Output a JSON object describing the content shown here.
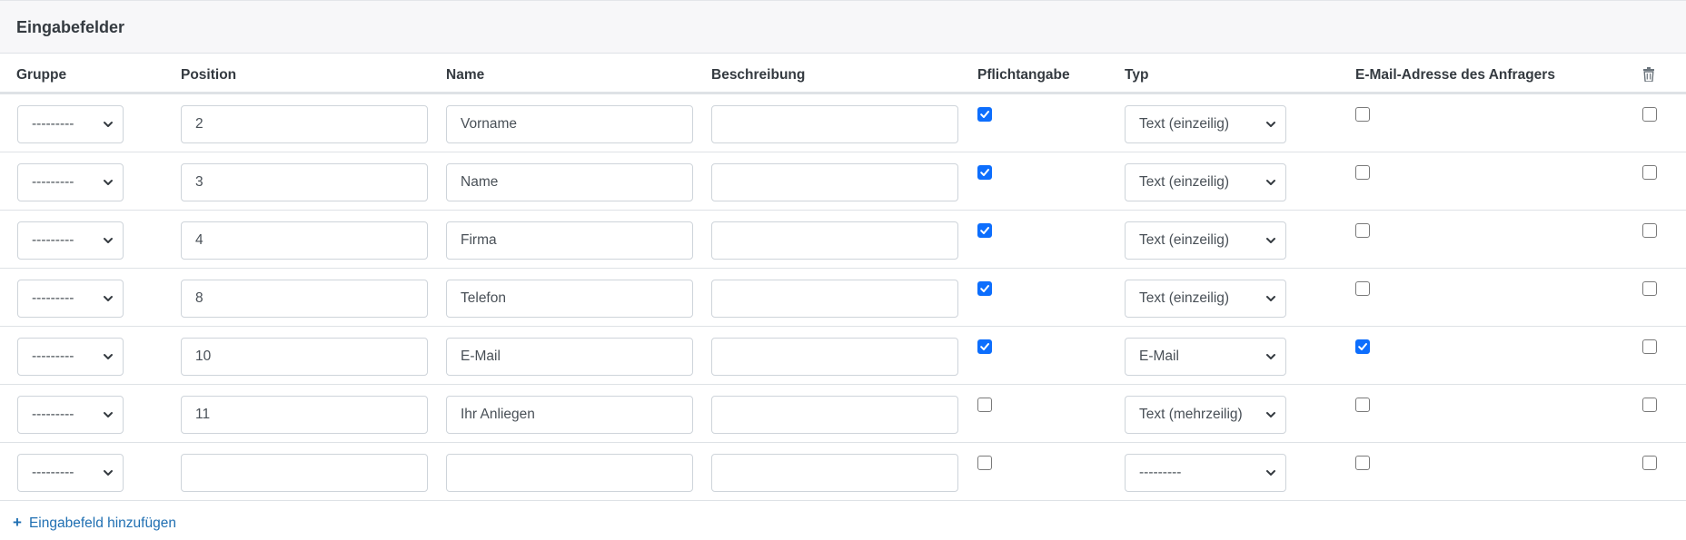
{
  "title": "Eingabefelder",
  "columns": {
    "gruppe": "Gruppe",
    "position": "Position",
    "name": "Name",
    "beschreibung": "Beschreibung",
    "pflicht": "Pflichtangabe",
    "typ": "Typ",
    "email": "E-Mail-Adresse des Anfragers",
    "delete_icon": "trash-icon"
  },
  "rows": [
    {
      "gruppe": "---------",
      "position": "2",
      "name": "Vorname",
      "beschreibung": "",
      "pflicht": true,
      "typ": "Text (einzeilig)",
      "email": false,
      "delete": false
    },
    {
      "gruppe": "---------",
      "position": "3",
      "name": "Name",
      "beschreibung": "",
      "pflicht": true,
      "typ": "Text (einzeilig)",
      "email": false,
      "delete": false
    },
    {
      "gruppe": "---------",
      "position": "4",
      "name": "Firma",
      "beschreibung": "",
      "pflicht": true,
      "typ": "Text (einzeilig)",
      "email": false,
      "delete": false
    },
    {
      "gruppe": "---------",
      "position": "8",
      "name": "Telefon",
      "beschreibung": "",
      "pflicht": true,
      "typ": "Text (einzeilig)",
      "email": false,
      "delete": false
    },
    {
      "gruppe": "---------",
      "position": "10",
      "name": "E-Mail",
      "beschreibung": "",
      "pflicht": true,
      "typ": "E-Mail",
      "email": true,
      "delete": false
    },
    {
      "gruppe": "---------",
      "position": "11",
      "name": "Ihr Anliegen",
      "beschreibung": "",
      "pflicht": false,
      "typ": "Text (mehrzeilig)",
      "email": false,
      "delete": false
    },
    {
      "gruppe": "---------",
      "position": "",
      "name": "",
      "beschreibung": "",
      "pflicht": false,
      "typ": "---------",
      "email": false,
      "delete": false
    }
  ],
  "add_link": {
    "icon": "plus-icon",
    "label": "Eingabefeld hinzufügen"
  },
  "colors": {
    "accent": "#0d6efd",
    "link": "#1f6fb2",
    "border": "#dee2e6"
  }
}
